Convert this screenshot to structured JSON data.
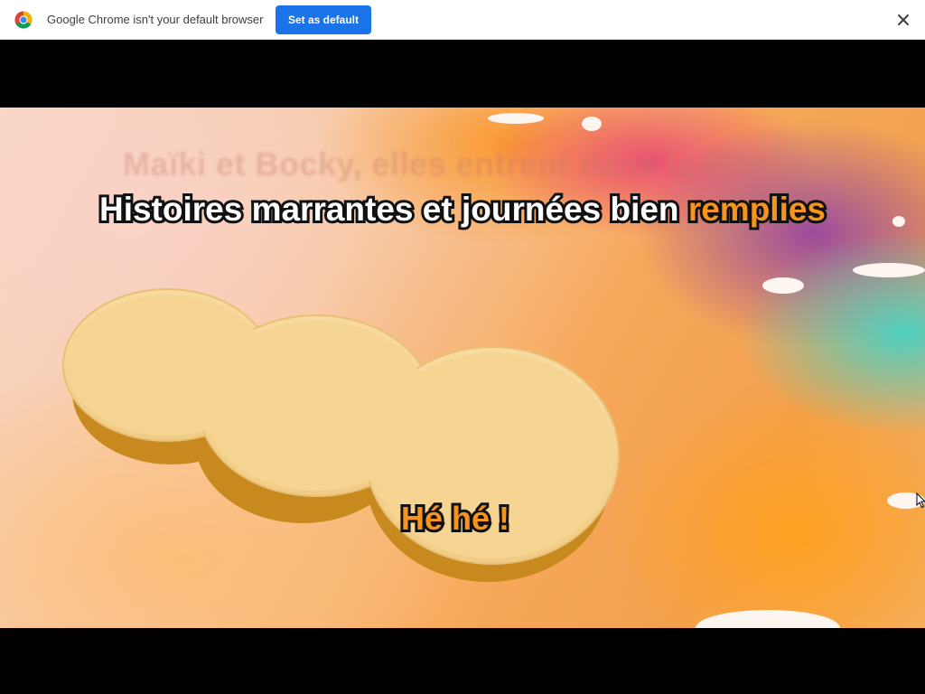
{
  "infobar": {
    "message": "Google Chrome isn't your default browser",
    "button_label": "Set as default",
    "close_icon": "close-icon",
    "logo_icon": "chrome-logo-icon"
  },
  "video": {
    "faded_lyric": "Maïki et Bocky, elles entrent dans la fête",
    "lyric_white": "Histoires marrantes et journées bien ",
    "lyric_highlight": "remplies",
    "lyric_bottom": "Hé hé !",
    "highlight_color": "#f7941d"
  }
}
